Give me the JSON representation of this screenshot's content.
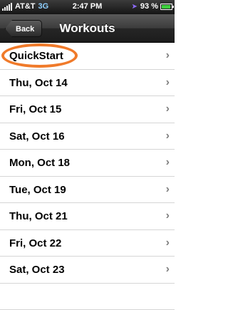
{
  "status_bar": {
    "carrier": "AT&T",
    "network": "3G",
    "time": "2:47 PM",
    "battery_text": "93 %",
    "battery_level": 0.93,
    "colors": {
      "network": "#8fd0ff",
      "location_arrow": "#8e6cff",
      "battery_fill": "#3ecf3e"
    }
  },
  "nav_bar": {
    "back_label": "Back",
    "title": "Workouts"
  },
  "workouts": [
    {
      "label": "QuickStart",
      "highlighted": true
    },
    {
      "label": "Thu, Oct 14"
    },
    {
      "label": "Fri, Oct 15"
    },
    {
      "label": "Sat, Oct 16"
    },
    {
      "label": "Mon, Oct 18"
    },
    {
      "label": "Tue, Oct 19"
    },
    {
      "label": "Thu, Oct 21"
    },
    {
      "label": "Fri, Oct 22"
    },
    {
      "label": "Sat, Oct 23"
    },
    {
      "label": ""
    }
  ],
  "annotation": {
    "color": "#f07a2a",
    "shape": "oval",
    "target": "QuickStart"
  },
  "icons": {
    "chevron": "chevron-right-icon",
    "signal": "signal-bars-icon",
    "location": "location-arrow-icon",
    "battery": "battery-icon"
  }
}
